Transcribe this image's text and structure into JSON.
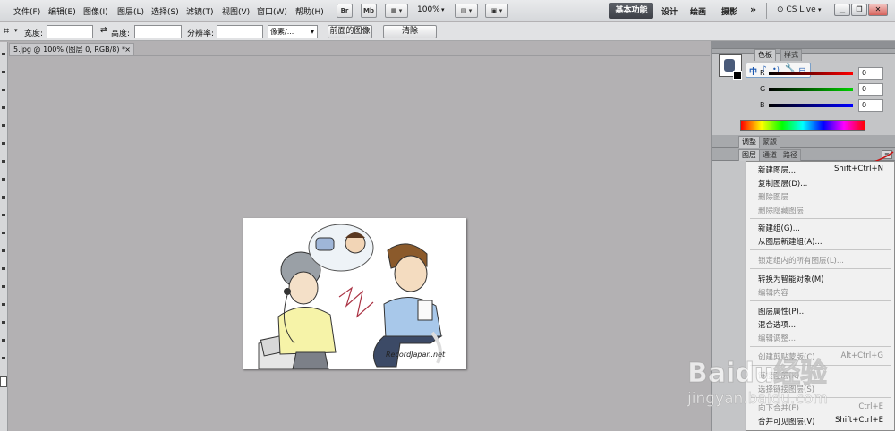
{
  "menubar": {
    "items": [
      "文件(F)",
      "编辑(E)",
      "图像(I)",
      "图层(L)",
      "选择(S)",
      "滤镜(T)",
      "视图(V)",
      "窗口(W)",
      "帮助(H)"
    ],
    "bridge_label": "Br",
    "mini_bridge_label": "Mb",
    "zoom": "100%",
    "workspaces": {
      "active": "基本功能",
      "design": "设计",
      "paint": "绘画",
      "photo": "摄影",
      "more": "»"
    },
    "cs_live": "CS Live"
  },
  "optbar": {
    "width_label": "宽度:",
    "swap_icon": "⇄",
    "height_label": "高度:",
    "resolution_label": "分辨率:",
    "unit_value": "像素/...",
    "front_image_button": "前面的图像",
    "clear_button": "清除"
  },
  "document": {
    "tab_title": "5.jpg @ 100% (图层 0, RGB/8) *",
    "watermark_text": "RecordJapan.net"
  },
  "panels": {
    "top_tabs": [
      "色板",
      "样式"
    ],
    "color": {
      "r_label": "R",
      "g_label": "G",
      "b_label": "B",
      "r": "0",
      "g": "0",
      "b": "0"
    },
    "popup_icons": [
      "中",
      "♪",
      "•)",
      "🔧",
      "目"
    ],
    "adjust_tabs": [
      "调整",
      "蒙版"
    ],
    "layers_tabs": [
      "图层",
      "通道",
      "路径"
    ]
  },
  "context_menu": {
    "items": [
      {
        "label": "新建图层...",
        "shortcut": "Shift+Ctrl+N",
        "disabled": false
      },
      {
        "label": "复制图层(D)...",
        "shortcut": "",
        "disabled": false
      },
      {
        "label": "删除图层",
        "shortcut": "",
        "disabled": true
      },
      {
        "label": "删除隐藏图层",
        "shortcut": "",
        "disabled": true
      },
      {
        "label": "新建组(G)...",
        "shortcut": "",
        "disabled": false
      },
      {
        "label": "从图层新建组(A)...",
        "shortcut": "",
        "disabled": false
      },
      {
        "label": "锁定组内的所有图层(L)...",
        "shortcut": "",
        "disabled": true
      },
      {
        "label": "转换为智能对象(M)",
        "shortcut": "",
        "disabled": false
      },
      {
        "label": "编辑内容",
        "shortcut": "",
        "disabled": true
      },
      {
        "label": "图层属性(P)...",
        "shortcut": "",
        "disabled": false
      },
      {
        "label": "混合选项...",
        "shortcut": "",
        "disabled": false
      },
      {
        "label": "编辑调整...",
        "shortcut": "",
        "disabled": true
      },
      {
        "label": "创建剪贴蒙版(C)",
        "shortcut": "Alt+Ctrl+G",
        "disabled": true
      },
      {
        "label": "链接图层(K)",
        "shortcut": "",
        "disabled": true
      },
      {
        "label": "选择链接图层(S)",
        "shortcut": "",
        "disabled": true
      },
      {
        "label": "向下合并(E)",
        "shortcut": "Ctrl+E",
        "disabled": true
      },
      {
        "label": "合并可见图层(V)",
        "shortcut": "Shift+Ctrl+E",
        "disabled": false
      }
    ]
  },
  "watermark": {
    "brand": "Baidu经验",
    "url": "jingyan.baidu.com"
  },
  "colors": {
    "workspace_active": "#4a4d54",
    "canvas": "#b3b1b3",
    "annotation": "#cc1111"
  }
}
